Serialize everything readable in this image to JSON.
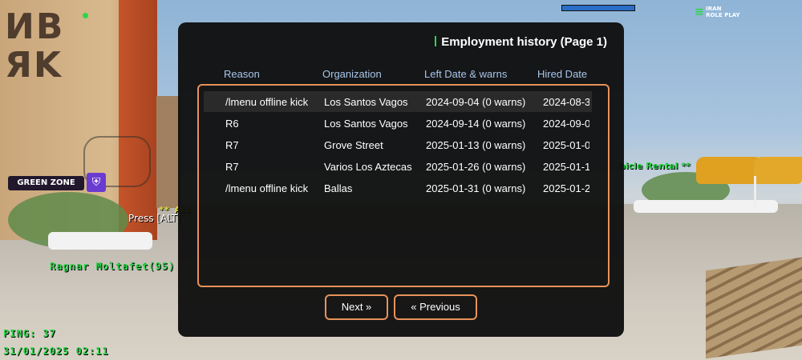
{
  "hud": {
    "green_zone": "GREEN ZONE",
    "press_text": "Press [ALT]",
    "assist_text": "** Ass",
    "player_name": "Ragnar Moltafet(95)",
    "ping": "PING: 37",
    "datetime": "31/01/2025 02:11",
    "vehicle_rental": "hicle Rental **",
    "server_logo_line1": "IRAN",
    "server_logo_line2": "ROLE PLAY"
  },
  "dialog": {
    "title": "Employment history (Page 1)",
    "columns": [
      "Reason",
      "Organization",
      "Left Date & warns",
      "Hired Date"
    ],
    "rows": [
      {
        "reason": "/lmenu offline kick",
        "organization": "Los Santos Vagos",
        "left": "2024-09-04 (0 warns)",
        "hired": "2024-08-3"
      },
      {
        "reason": "R6",
        "organization": "Los Santos Vagos",
        "left": "2024-09-14 (0 warns)",
        "hired": "2024-09-0"
      },
      {
        "reason": "R7",
        "organization": "Grove Street",
        "left": "2025-01-13 (0 warns)",
        "hired": "2025-01-0"
      },
      {
        "reason": "R7",
        "organization": "Varios Los Aztecas",
        "left": "2025-01-26 (0 warns)",
        "hired": "2025-01-1"
      },
      {
        "reason": "/lmenu offline kick",
        "organization": "Ballas",
        "left": "2025-01-31 (0 warns)",
        "hired": "2025-01-2"
      }
    ],
    "next_label": "Next »",
    "previous_label": "« Previous"
  },
  "colors": {
    "accent_border": "#e8925a",
    "header_text": "#a9c6ea",
    "hud_green": "#2cd64a",
    "dialog_bg": "#0c0c0c"
  }
}
